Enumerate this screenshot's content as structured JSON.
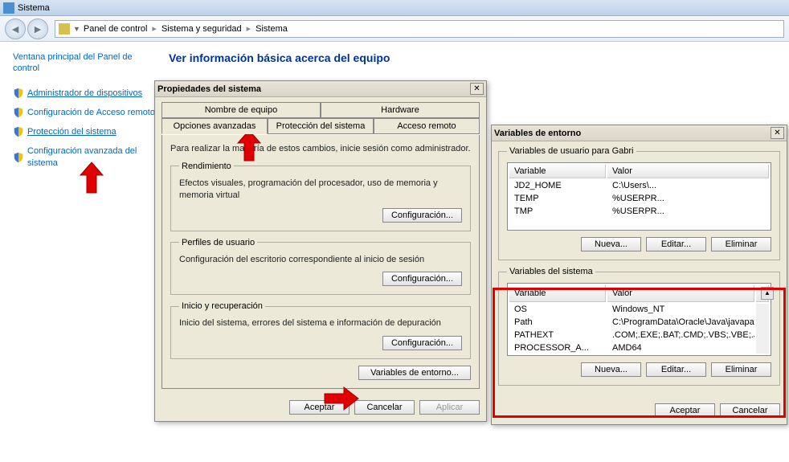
{
  "window": {
    "title": "Sistema"
  },
  "breadcrumbs": {
    "root": "Panel de control",
    "seg1": "Sistema y seguridad",
    "seg2": "Sistema"
  },
  "sidebar": {
    "home": "Ventana principal del Panel de control",
    "items": [
      {
        "label": "Administrador de dispositivos"
      },
      {
        "label": "Configuración de Acceso remoto"
      },
      {
        "label": "Protección del sistema"
      },
      {
        "label": "Configuración avanzada del sistema"
      }
    ]
  },
  "main": {
    "heading": "Ver información básica acerca del equipo"
  },
  "sysprops": {
    "title": "Propiedades del sistema",
    "tabs": {
      "computer_name": "Nombre de equipo",
      "hardware": "Hardware",
      "advanced": "Opciones avanzadas",
      "protection": "Protección del sistema",
      "remote": "Acceso remoto"
    },
    "intro": "Para realizar la mayoría de estos cambios, inicie sesión como administrador.",
    "perf": {
      "legend": "Rendimiento",
      "text": "Efectos visuales, programación del procesador, uso de memoria y memoria virtual",
      "btn": "Configuración..."
    },
    "profiles": {
      "legend": "Perfiles de usuario",
      "text": "Configuración del escritorio correspondiente al inicio de sesión",
      "btn": "Configuración..."
    },
    "startup": {
      "legend": "Inicio y recuperación",
      "text": "Inicio del sistema, errores del sistema e información de depuración",
      "btn": "Configuración..."
    },
    "envvars_btn": "Variables de entorno...",
    "ok": "Aceptar",
    "cancel": "Cancelar",
    "apply": "Aplicar"
  },
  "envdlg": {
    "title": "Variables de entorno",
    "user_legend": "Variables de usuario para Gabri",
    "col_var": "Variable",
    "col_val": "Valor",
    "user_vars": [
      {
        "name": "JD2_HOME",
        "value": "C:\\Users\\..."
      },
      {
        "name": "TEMP",
        "value": "%USERPR..."
      },
      {
        "name": "TMP",
        "value": "%USERPR..."
      }
    ],
    "sys_legend": "Variables del sistema",
    "sys_vars": [
      {
        "name": "OS",
        "value": "Windows_NT"
      },
      {
        "name": "Path",
        "value": "C:\\ProgramData\\Oracle\\Java\\javapath;..."
      },
      {
        "name": "PATHEXT",
        "value": ".COM;.EXE;.BAT;.CMD;.VBS;.VBE;.JS;..."
      },
      {
        "name": "PROCESSOR_A...",
        "value": "AMD64"
      }
    ],
    "new": "Nueva...",
    "edit": "Editar...",
    "delete": "Eliminar",
    "ok": "Aceptar",
    "cancel": "Cancelar"
  }
}
